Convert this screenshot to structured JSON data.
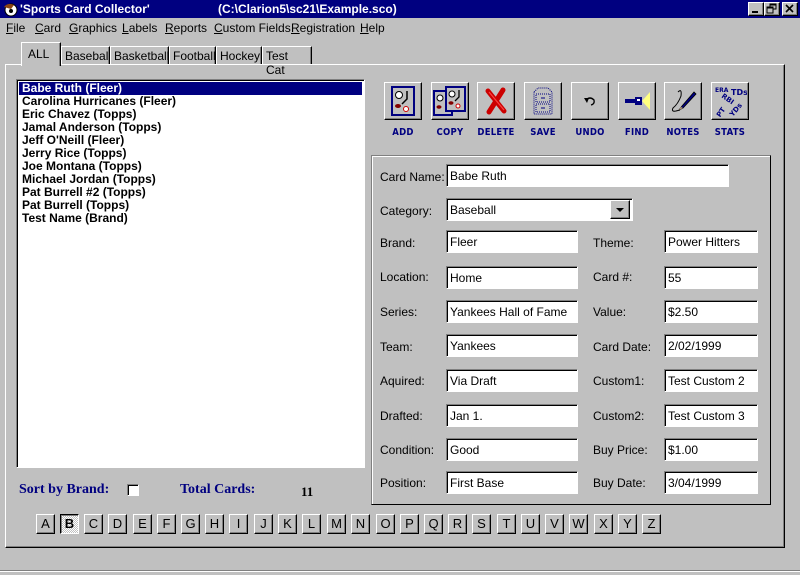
{
  "window": {
    "title": "'Sports Card Collector'",
    "path": "(C:\\Clarion5\\sc21\\Example.sco)",
    "controls": {
      "minimize": "_",
      "restore": "❐",
      "close": "✕"
    }
  },
  "menu": [
    {
      "label": "File",
      "accel": "F",
      "rest": "ile"
    },
    {
      "label": "Card",
      "accel": "C",
      "rest": "ard"
    },
    {
      "label": "Graphics",
      "accel": "G",
      "rest": "raphics"
    },
    {
      "label": "Labels",
      "accel": "L",
      "rest": "abels"
    },
    {
      "label": "Reports",
      "accel": "R",
      "rest": "eports"
    },
    {
      "label": "Custom Fields",
      "accel": "C",
      "rest": "ustom Fields"
    },
    {
      "label": "Registration",
      "accel": "R",
      "rest": "egistration"
    },
    {
      "label": "Help",
      "accel": "H",
      "rest": "elp"
    }
  ],
  "tabs": [
    {
      "label": "ALL",
      "active": true
    },
    {
      "label": "Baseball"
    },
    {
      "label": "Basketball"
    },
    {
      "label": "Football"
    },
    {
      "label": "Hockey"
    },
    {
      "label": "Test Cat"
    }
  ],
  "card_list": {
    "selected_index": 0,
    "items": [
      "Babe Ruth (Fleer)",
      "Carolina Hurricanes (Fleer)",
      "Eric Chavez (Topps)",
      "Jamal Anderson (Topps)",
      "Jeff O'Neill (Fleer)",
      "Jerry Rice (Topps)",
      "Joe Montana (Topps)",
      "Michael Jordan (Topps)",
      "Pat Burrell #2 (Topps)",
      "Pat Burrell (Topps)",
      "Test Name (Brand)"
    ]
  },
  "sort_by_brand": {
    "label": "Sort by Brand:",
    "checked": false
  },
  "total_cards": {
    "label": "Total Cards:",
    "value": "11"
  },
  "toolbar": [
    {
      "id": "add",
      "label": "ADD",
      "icon": "card-icon"
    },
    {
      "id": "copy",
      "label": "COPY",
      "icon": "copy-cards-icon"
    },
    {
      "id": "delete",
      "label": "DELETE",
      "icon": "red-x-icon"
    },
    {
      "id": "save",
      "label": "SAVE",
      "icon": "file-cabinet-icon"
    },
    {
      "id": "undo",
      "label": "UNDO",
      "icon": "undo-arrow-icon"
    },
    {
      "id": "find",
      "label": "FIND",
      "icon": "flashlight-icon"
    },
    {
      "id": "notes",
      "label": "NOTES",
      "icon": "pencil-icon"
    },
    {
      "id": "stats",
      "label": "STATS",
      "icon": "stats-icon"
    }
  ],
  "stats_icon_text": {
    "era": "ERA",
    "tds": "TDs",
    "rbi": "RBI",
    "yds": "YDs",
    "pt": "PT"
  },
  "form": {
    "card_name": {
      "label": "Card Name:",
      "value": "Babe Ruth"
    },
    "category": {
      "label": "Category:",
      "value": "Baseball"
    },
    "brand": {
      "label": "Brand:",
      "value": "Fleer"
    },
    "theme": {
      "label": "Theme:",
      "value": "Power Hitters"
    },
    "location": {
      "label": "Location:",
      "value": "Home"
    },
    "card_no": {
      "label": "Card #:",
      "value": "55"
    },
    "series": {
      "label": "Series:",
      "value": "Yankees Hall of Fame"
    },
    "value": {
      "label": "Value:",
      "value": "$2.50"
    },
    "team": {
      "label": "Team:",
      "value": "Yankees"
    },
    "card_date": {
      "label": "Card Date:",
      "value": "2/02/1999"
    },
    "aquired": {
      "label": "Aquired:",
      "value": "Via Draft"
    },
    "custom1": {
      "label": "Custom1:",
      "value": "Test Custom 2"
    },
    "drafted": {
      "label": "Drafted:",
      "value": "Jan 1."
    },
    "custom2": {
      "label": "Custom2:",
      "value": "Test Custom 3"
    },
    "condition": {
      "label": "Condition:",
      "value": "Good"
    },
    "buy_price": {
      "label": "Buy Price:",
      "value": "$1.00"
    },
    "position": {
      "label": "Position:",
      "value": "First Base"
    },
    "buy_date": {
      "label": "Buy Date:",
      "value": "3/04/1999"
    }
  },
  "letters": {
    "pressed": "B",
    "items": [
      "A",
      "B",
      "C",
      "D",
      "E",
      "F",
      "G",
      "H",
      "I",
      "J",
      "K",
      "L",
      "M",
      "N",
      "O",
      "P",
      "Q",
      "R",
      "S",
      "T",
      "U",
      "V",
      "W",
      "X",
      "Y",
      "Z"
    ]
  },
  "colors": {
    "title_bar": "#000080",
    "face": "#c0c0c0",
    "label_blue": "#000080",
    "delete_red": "#cc0000"
  }
}
